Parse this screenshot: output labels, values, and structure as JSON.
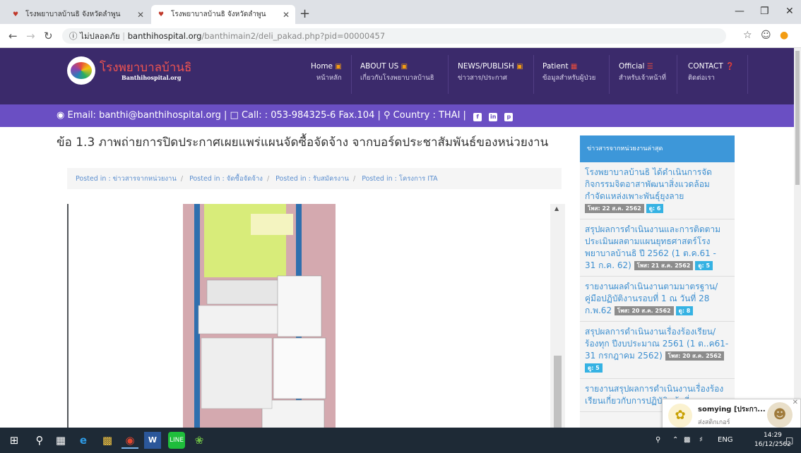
{
  "browser": {
    "tabs": [
      {
        "title": "โรงพยาบาลบ้านธิ จังหวัดลำพูน",
        "active": false
      },
      {
        "title": "โรงพยาบาลบ้านธิ จังหวัดลำพูน",
        "active": true
      }
    ],
    "url_secure": "ไม่ปลอดภัย",
    "url_domain": "banthihospital.org",
    "url_path": "/banthimain2/deli_pakad.php?pid=00000457"
  },
  "site": {
    "logo_th": "โรงพยาบาลบ้านธิ",
    "logo_en": "Banthihospital.org",
    "menu": [
      {
        "en": "Home",
        "th": "หน้าหลัก",
        "icon": "folder-icon"
      },
      {
        "en": "ABOUT US",
        "th": "เกี่ยวกับโรงพยาบาลบ้านธิ",
        "icon": "folder-icon"
      },
      {
        "en": "NEWS/PUBLISH",
        "th": "ข่าวสาร/ประกาศ",
        "icon": "folder-icon"
      },
      {
        "en": "Patient",
        "th": "ข้อมูลสำหรับผู้ป่วย",
        "icon": "image-icon"
      },
      {
        "en": "Official",
        "th": "สำหรับเจ้าหน้าที่",
        "icon": "menu-icon"
      },
      {
        "en": "CONTACT",
        "th": "ติดต่อเรา",
        "icon": "question-icon"
      }
    ],
    "contact": {
      "email": "Email: banthi@banthihospital.org",
      "call": "Call: : 053-984325-6 Fax.104",
      "country": "Country : THAI",
      "social": [
        "f",
        "in",
        "p"
      ]
    }
  },
  "article": {
    "title": "ข้อ 1.3 ภาพถ่ายการปิดประกาศเผยแพร่แผนจัดซื้อจัดจ้าง จากบอร์ดประชาสัมพันธ์ของหน่วยงาน",
    "posted": [
      "Posted in : ข่าวสารจากหน่วยงาน",
      "Posted in : จัดซื้อจัดจ้าง",
      "Posted in : รับสมัครงาน",
      "Posted in : โครงการ ITA"
    ]
  },
  "sidebar": {
    "header": "ข่าวสารจากหน่วยงานล่าสุด",
    "items": [
      {
        "title": "โรงพยาบาลบ้านธิ ได้ดำเนินการจัดกิจกรรมจิตอาสาพัฒนาสิ่งแวดล้อมกำจัดแหล่งเพาะพันธุ์ยุงลาย",
        "date": "โพส: 22 ส.ค. 2562",
        "views": "ดู: 6"
      },
      {
        "title": "สรุปผลการดำเนินงานและการติดตามประเมินผลตามแผนยุทธศาสตร์โรงพยาบาลบ้านธิ ปี 2562 (1 ต.ค.61 - 31 ก.ค. 62)",
        "date": "โพส: 21 ส.ค. 2562",
        "views": "ดู: 5"
      },
      {
        "title": "รายงานผลดำเนินงานตามมาตรฐาน/คู่มือปฏิบัติงานรอบที่ 1 ณ วันที่ 28 ก.พ.62",
        "date": "โพส: 20 ส.ค. 2562",
        "views": "ดู: 8"
      },
      {
        "title": "สรุปผลการดำเนินงานเรื่องร้องเรียน/ร้องทุก ปีงบประมาณ 2561 (1 ต..ค61-31 กรกฎาคม 2562)",
        "date": "โพส: 20 ส.ค. 2562",
        "views": "ดู: 5"
      },
      {
        "title": "รายงานสรุปผลการดำเนินงานเรื่องร้องเรียนเกี่ยวกับการปฏิบัติหน้าที่",
        "date": "",
        "views": ""
      }
    ]
  },
  "notification": {
    "name": "somying [ประกา...",
    "sub": "ส่งสติกเกอร์"
  },
  "taskbar": {
    "lang": "ENG",
    "time": "14:29",
    "date": "16/12/2562"
  }
}
